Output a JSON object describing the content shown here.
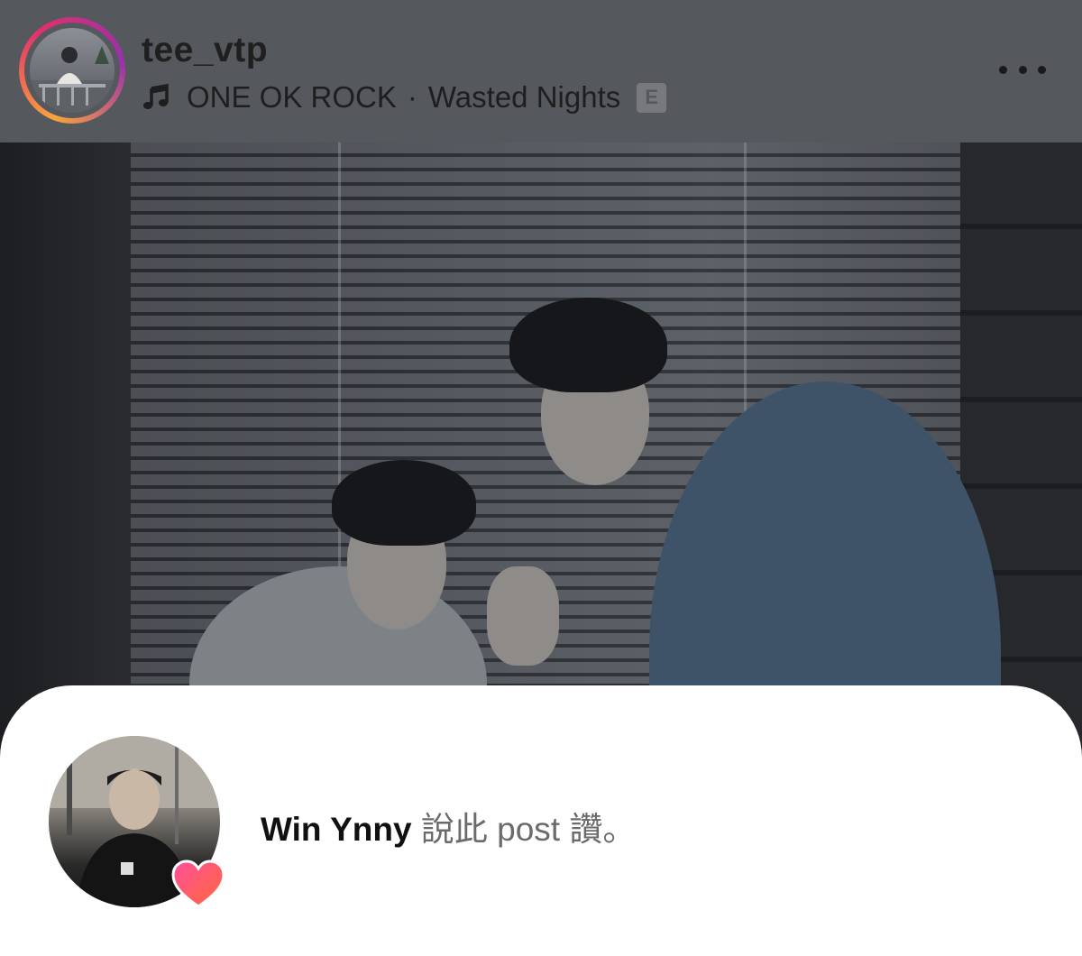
{
  "header": {
    "username": "tee_vtp",
    "music": {
      "artist": "ONE OK ROCK",
      "separator": "·",
      "track": "Wasted Nights",
      "explicit_badge": "E"
    },
    "more_icon": "more-horizontal-icon"
  },
  "post": {
    "image_description_icon": "photo"
  },
  "like_notice": {
    "name": "Win Ynny",
    "message": " 說此 post 讚。",
    "badge_icon": "heart-icon"
  },
  "colors": {
    "header_bg": "#55585d",
    "sheet_bg": "#ffffff",
    "story_ring": "#e1306c",
    "heart": "#f0566a"
  }
}
